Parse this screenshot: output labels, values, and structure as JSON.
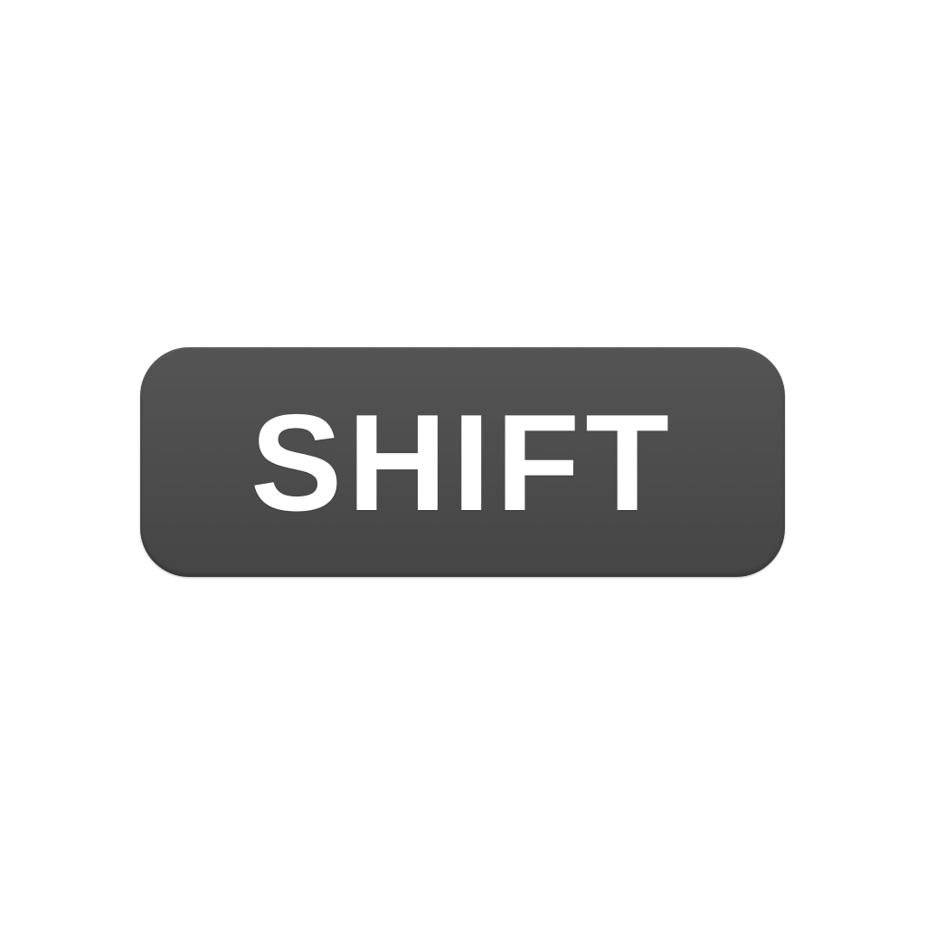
{
  "key": {
    "label": "SHIFT"
  },
  "colors": {
    "background": "#ffffff",
    "key_fill": "#4c4c4c",
    "label": "#ffffff"
  }
}
